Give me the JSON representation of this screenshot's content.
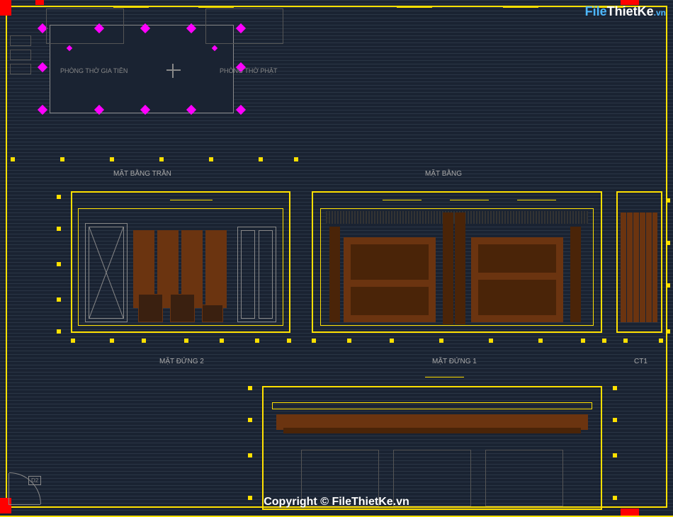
{
  "logo": {
    "part1": "File",
    "part2": "ThietKe",
    "part3": ".vn"
  },
  "watermark": "Copyright © FileThietKe.vn",
  "drawings": {
    "ceiling_plan": {
      "label": "MẶT BẰNG TRẦN"
    },
    "floor_plan": {
      "label": "MẶT BẰNG",
      "room1": "PHÒNG THỜ GIA TIÊN",
      "room2": "PHÒNG THỜ PHẬT",
      "door_tag": "D2"
    },
    "elevation_2": {
      "label": "MẶT ĐỨNG 2"
    },
    "elevation_1": {
      "label": "MẶT ĐỨNG 1"
    },
    "ct1": {
      "label": "CT1"
    }
  },
  "colors": {
    "background": "#1a2332",
    "dimension": "#ffe000",
    "wall_highlight": "#ff0000",
    "light_fixture": "#ff00ff",
    "wood": "#6b3410",
    "text": "#888888"
  }
}
